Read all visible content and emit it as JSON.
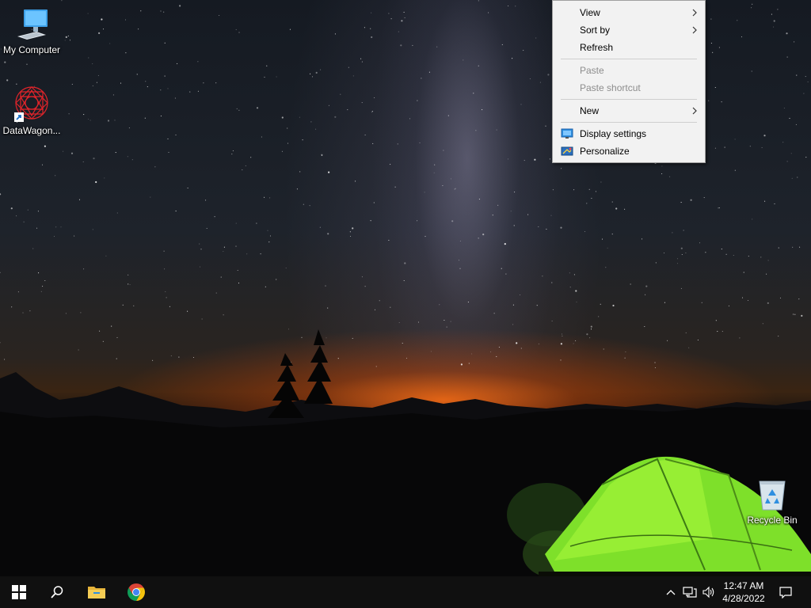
{
  "desktop": {
    "icons": [
      {
        "label": "My Computer",
        "icon": "computer-icon"
      },
      {
        "label": "DataWagon...",
        "icon": "datawagon-shortcut-icon"
      },
      {
        "label": "Recycle Bin",
        "icon": "recycle-bin-icon"
      }
    ]
  },
  "context_menu": {
    "items": [
      {
        "label": "View",
        "has_submenu": true,
        "disabled": false
      },
      {
        "label": "Sort by",
        "has_submenu": true,
        "disabled": false
      },
      {
        "label": "Refresh",
        "has_submenu": false,
        "disabled": false
      },
      {
        "label": "Paste",
        "has_submenu": false,
        "disabled": true
      },
      {
        "label": "Paste shortcut",
        "has_submenu": false,
        "disabled": true
      },
      {
        "label": "New",
        "has_submenu": true,
        "disabled": false
      },
      {
        "label": "Display settings",
        "icon": "display-icon",
        "disabled": false
      },
      {
        "label": "Personalize",
        "icon": "personalize-icon",
        "disabled": false
      }
    ]
  },
  "taskbar": {
    "pinned": [
      {
        "name": "start",
        "icon": "windows-logo-icon"
      },
      {
        "name": "search",
        "icon": "search-icon"
      },
      {
        "name": "file-explorer",
        "icon": "folder-icon"
      },
      {
        "name": "chrome",
        "icon": "chrome-icon"
      }
    ],
    "tray": {
      "icons": [
        "chevron-up-icon",
        "network-icon",
        "volume-icon",
        "notification-icon"
      ],
      "time": "12:47 AM",
      "date": "4/28/2022"
    }
  },
  "colors": {
    "menu_bg": "#f2f2f2",
    "taskbar_bg": "#101010",
    "tent_green": "#7ee02a",
    "horizon_orange": "#ff6e14"
  }
}
